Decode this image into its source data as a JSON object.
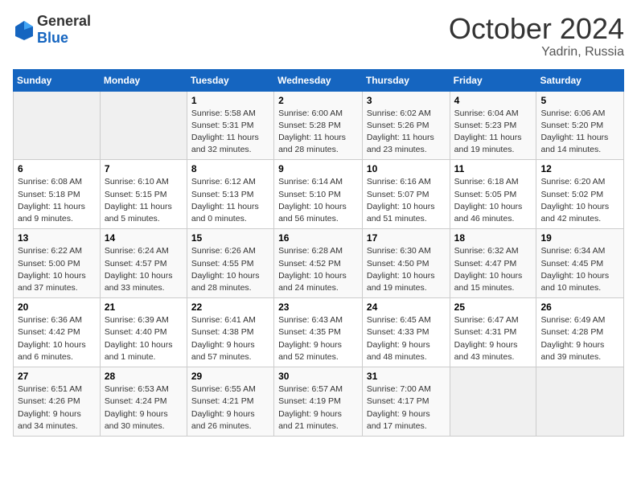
{
  "header": {
    "logo": {
      "general": "General",
      "blue": "Blue"
    },
    "title": "October 2024",
    "location": "Yadrin, Russia"
  },
  "weekdays": [
    "Sunday",
    "Monday",
    "Tuesday",
    "Wednesday",
    "Thursday",
    "Friday",
    "Saturday"
  ],
  "weeks": [
    [
      {
        "day": "",
        "sunrise": "",
        "sunset": "",
        "daylight": ""
      },
      {
        "day": "",
        "sunrise": "",
        "sunset": "",
        "daylight": ""
      },
      {
        "day": "1",
        "sunrise": "Sunrise: 5:58 AM",
        "sunset": "Sunset: 5:31 PM",
        "daylight": "Daylight: 11 hours and 32 minutes."
      },
      {
        "day": "2",
        "sunrise": "Sunrise: 6:00 AM",
        "sunset": "Sunset: 5:28 PM",
        "daylight": "Daylight: 11 hours and 28 minutes."
      },
      {
        "day": "3",
        "sunrise": "Sunrise: 6:02 AM",
        "sunset": "Sunset: 5:26 PM",
        "daylight": "Daylight: 11 hours and 23 minutes."
      },
      {
        "day": "4",
        "sunrise": "Sunrise: 6:04 AM",
        "sunset": "Sunset: 5:23 PM",
        "daylight": "Daylight: 11 hours and 19 minutes."
      },
      {
        "day": "5",
        "sunrise": "Sunrise: 6:06 AM",
        "sunset": "Sunset: 5:20 PM",
        "daylight": "Daylight: 11 hours and 14 minutes."
      }
    ],
    [
      {
        "day": "6",
        "sunrise": "Sunrise: 6:08 AM",
        "sunset": "Sunset: 5:18 PM",
        "daylight": "Daylight: 11 hours and 9 minutes."
      },
      {
        "day": "7",
        "sunrise": "Sunrise: 6:10 AM",
        "sunset": "Sunset: 5:15 PM",
        "daylight": "Daylight: 11 hours and 5 minutes."
      },
      {
        "day": "8",
        "sunrise": "Sunrise: 6:12 AM",
        "sunset": "Sunset: 5:13 PM",
        "daylight": "Daylight: 11 hours and 0 minutes."
      },
      {
        "day": "9",
        "sunrise": "Sunrise: 6:14 AM",
        "sunset": "Sunset: 5:10 PM",
        "daylight": "Daylight: 10 hours and 56 minutes."
      },
      {
        "day": "10",
        "sunrise": "Sunrise: 6:16 AM",
        "sunset": "Sunset: 5:07 PM",
        "daylight": "Daylight: 10 hours and 51 minutes."
      },
      {
        "day": "11",
        "sunrise": "Sunrise: 6:18 AM",
        "sunset": "Sunset: 5:05 PM",
        "daylight": "Daylight: 10 hours and 46 minutes."
      },
      {
        "day": "12",
        "sunrise": "Sunrise: 6:20 AM",
        "sunset": "Sunset: 5:02 PM",
        "daylight": "Daylight: 10 hours and 42 minutes."
      }
    ],
    [
      {
        "day": "13",
        "sunrise": "Sunrise: 6:22 AM",
        "sunset": "Sunset: 5:00 PM",
        "daylight": "Daylight: 10 hours and 37 minutes."
      },
      {
        "day": "14",
        "sunrise": "Sunrise: 6:24 AM",
        "sunset": "Sunset: 4:57 PM",
        "daylight": "Daylight: 10 hours and 33 minutes."
      },
      {
        "day": "15",
        "sunrise": "Sunrise: 6:26 AM",
        "sunset": "Sunset: 4:55 PM",
        "daylight": "Daylight: 10 hours and 28 minutes."
      },
      {
        "day": "16",
        "sunrise": "Sunrise: 6:28 AM",
        "sunset": "Sunset: 4:52 PM",
        "daylight": "Daylight: 10 hours and 24 minutes."
      },
      {
        "day": "17",
        "sunrise": "Sunrise: 6:30 AM",
        "sunset": "Sunset: 4:50 PM",
        "daylight": "Daylight: 10 hours and 19 minutes."
      },
      {
        "day": "18",
        "sunrise": "Sunrise: 6:32 AM",
        "sunset": "Sunset: 4:47 PM",
        "daylight": "Daylight: 10 hours and 15 minutes."
      },
      {
        "day": "19",
        "sunrise": "Sunrise: 6:34 AM",
        "sunset": "Sunset: 4:45 PM",
        "daylight": "Daylight: 10 hours and 10 minutes."
      }
    ],
    [
      {
        "day": "20",
        "sunrise": "Sunrise: 6:36 AM",
        "sunset": "Sunset: 4:42 PM",
        "daylight": "Daylight: 10 hours and 6 minutes."
      },
      {
        "day": "21",
        "sunrise": "Sunrise: 6:39 AM",
        "sunset": "Sunset: 4:40 PM",
        "daylight": "Daylight: 10 hours and 1 minute."
      },
      {
        "day": "22",
        "sunrise": "Sunrise: 6:41 AM",
        "sunset": "Sunset: 4:38 PM",
        "daylight": "Daylight: 9 hours and 57 minutes."
      },
      {
        "day": "23",
        "sunrise": "Sunrise: 6:43 AM",
        "sunset": "Sunset: 4:35 PM",
        "daylight": "Daylight: 9 hours and 52 minutes."
      },
      {
        "day": "24",
        "sunrise": "Sunrise: 6:45 AM",
        "sunset": "Sunset: 4:33 PM",
        "daylight": "Daylight: 9 hours and 48 minutes."
      },
      {
        "day": "25",
        "sunrise": "Sunrise: 6:47 AM",
        "sunset": "Sunset: 4:31 PM",
        "daylight": "Daylight: 9 hours and 43 minutes."
      },
      {
        "day": "26",
        "sunrise": "Sunrise: 6:49 AM",
        "sunset": "Sunset: 4:28 PM",
        "daylight": "Daylight: 9 hours and 39 minutes."
      }
    ],
    [
      {
        "day": "27",
        "sunrise": "Sunrise: 6:51 AM",
        "sunset": "Sunset: 4:26 PM",
        "daylight": "Daylight: 9 hours and 34 minutes."
      },
      {
        "day": "28",
        "sunrise": "Sunrise: 6:53 AM",
        "sunset": "Sunset: 4:24 PM",
        "daylight": "Daylight: 9 hours and 30 minutes."
      },
      {
        "day": "29",
        "sunrise": "Sunrise: 6:55 AM",
        "sunset": "Sunset: 4:21 PM",
        "daylight": "Daylight: 9 hours and 26 minutes."
      },
      {
        "day": "30",
        "sunrise": "Sunrise: 6:57 AM",
        "sunset": "Sunset: 4:19 PM",
        "daylight": "Daylight: 9 hours and 21 minutes."
      },
      {
        "day": "31",
        "sunrise": "Sunrise: 7:00 AM",
        "sunset": "Sunset: 4:17 PM",
        "daylight": "Daylight: 9 hours and 17 minutes."
      },
      {
        "day": "",
        "sunrise": "",
        "sunset": "",
        "daylight": ""
      },
      {
        "day": "",
        "sunrise": "",
        "sunset": "",
        "daylight": ""
      }
    ]
  ]
}
